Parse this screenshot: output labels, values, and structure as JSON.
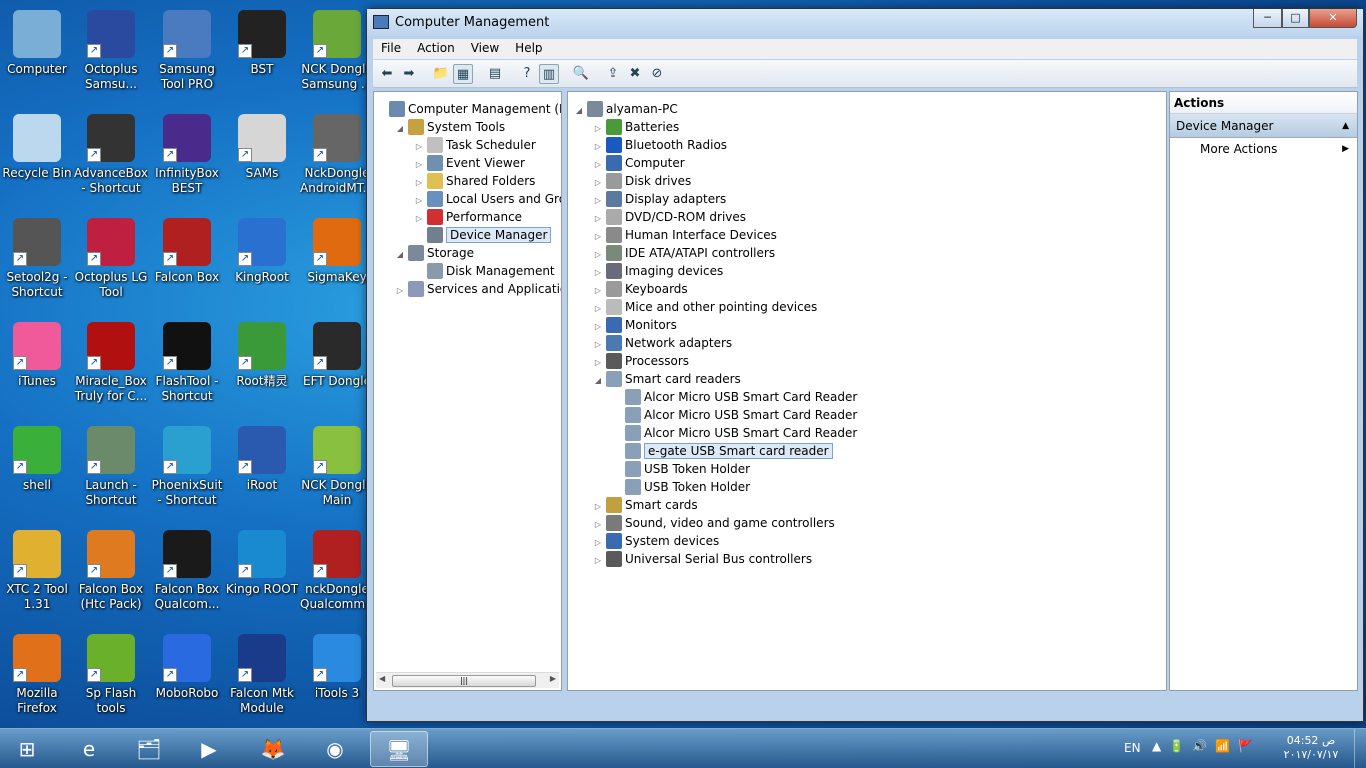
{
  "desktop": {
    "icons": [
      {
        "label": "Computer",
        "color": "#7aaed6"
      },
      {
        "label": "Octoplus Samsu...",
        "color": "#2a4aa0"
      },
      {
        "label": "Samsung Tool PRO",
        "color": "#4a7ac0"
      },
      {
        "label": "BST",
        "color": "#222222"
      },
      {
        "label": "NCK Dongle Samsung ...",
        "color": "#6aa83a"
      },
      {
        "label": "Recycle Bin",
        "color": "#bcd8ee"
      },
      {
        "label": "AdvanceBox - Shortcut",
        "color": "#333333"
      },
      {
        "label": "InfinityBox BEST",
        "color": "#4a2a8a"
      },
      {
        "label": "SAMs",
        "color": "#d6d6d6"
      },
      {
        "label": "NckDongle AndroidMT...",
        "color": "#666666"
      },
      {
        "label": "Setool2g - Shortcut",
        "color": "#555555"
      },
      {
        "label": "Octoplus LG Tool",
        "color": "#c02040"
      },
      {
        "label": "Falcon Box",
        "color": "#b02020"
      },
      {
        "label": "KingRoot",
        "color": "#2a70d0"
      },
      {
        "label": "SigmaKey",
        "color": "#e06a10"
      },
      {
        "label": "iTunes",
        "color": "#f05a9a"
      },
      {
        "label": "Miracle_Box Truly for C...",
        "color": "#b01010"
      },
      {
        "label": "FlashTool - Shortcut",
        "color": "#111111"
      },
      {
        "label": "Root精灵",
        "color": "#3a9a3a"
      },
      {
        "label": "EFT Dongle",
        "color": "#2a2a2a"
      },
      {
        "label": "shell",
        "color": "#3ab03a"
      },
      {
        "label": "Launch - Shortcut",
        "color": "#6a8a6a"
      },
      {
        "label": "PhoenixSuit - Shortcut",
        "color": "#2aa0d0"
      },
      {
        "label": "iRoot",
        "color": "#2a5ab0"
      },
      {
        "label": "NCK Dongle Main Modu...",
        "color": "#8ac040"
      },
      {
        "label": "XTC 2 Tool 1.31",
        "color": "#e0b030"
      },
      {
        "label": "Falcon Box (Htc Pack)",
        "color": "#e07a20"
      },
      {
        "label": "Falcon Box Qualcom...",
        "color": "#1a1a1a"
      },
      {
        "label": "Kingo ROOT",
        "color": "#1a8ad0"
      },
      {
        "label": "nckDongle Qualcomm...",
        "color": "#b02020"
      },
      {
        "label": "Mozilla Firefox",
        "color": "#e0701a"
      },
      {
        "label": "Sp Flash tools",
        "color": "#6ab02a"
      },
      {
        "label": "MoboRobo",
        "color": "#2a6ae0"
      },
      {
        "label": "Falcon Mtk Module",
        "color": "#1a3a8a"
      },
      {
        "label": "iTools 3",
        "color": "#2a8ae0"
      }
    ]
  },
  "window": {
    "title": "Computer Management",
    "minimize": "─",
    "maximize": "□",
    "close": "✕"
  },
  "menu": [
    "File",
    "Action",
    "View",
    "Help"
  ],
  "toolbar": [
    "back-icon",
    "forward-icon",
    "up-folder-icon",
    "show-hide-tree-icon",
    "properties-icon",
    "help-icon",
    "show-hide-action-pane-icon",
    "scan-hardware-icon",
    "update-driver-icon",
    "uninstall-icon",
    "disable-icon"
  ],
  "left_tree": [
    {
      "label": "Computer Management (Local",
      "exp": "",
      "color": "#6a8ab0",
      "indent": 0
    },
    {
      "label": "System Tools",
      "exp": "◢",
      "color": "#c8a040",
      "indent": 1
    },
    {
      "label": "Task Scheduler",
      "exp": "▷",
      "color": "#c0c0c0",
      "indent": 2
    },
    {
      "label": "Event Viewer",
      "exp": "▷",
      "color": "#7090b0",
      "indent": 2
    },
    {
      "label": "Shared Folders",
      "exp": "▷",
      "color": "#e0c050",
      "indent": 2
    },
    {
      "label": "Local Users and Groups",
      "exp": "▷",
      "color": "#6a90c0",
      "indent": 2
    },
    {
      "label": "Performance",
      "exp": "▷",
      "color": "#d03030",
      "indent": 2
    },
    {
      "label": "Device Manager",
      "exp": "",
      "color": "#708090",
      "indent": 2,
      "selected": true
    },
    {
      "label": "Storage",
      "exp": "◢",
      "color": "#7a8a9a",
      "indent": 1
    },
    {
      "label": "Disk Management",
      "exp": "",
      "color": "#8a9aaa",
      "indent": 2
    },
    {
      "label": "Services and Applications",
      "exp": "▷",
      "color": "#8a9ab8",
      "indent": 1
    }
  ],
  "device_tree": [
    {
      "label": "alyaman-PC",
      "exp": "◢",
      "color": "#7a8a9a",
      "indent": 0
    },
    {
      "label": "Batteries",
      "exp": "▷",
      "color": "#4a9a3a",
      "indent": 1
    },
    {
      "label": "Bluetooth Radios",
      "exp": "▷",
      "color": "#1a5ac0",
      "indent": 1
    },
    {
      "label": "Computer",
      "exp": "▷",
      "color": "#3a6ab0",
      "indent": 1
    },
    {
      "label": "Disk drives",
      "exp": "▷",
      "color": "#9a9a9a",
      "indent": 1
    },
    {
      "label": "Display adapters",
      "exp": "▷",
      "color": "#5a7aa0",
      "indent": 1
    },
    {
      "label": "DVD/CD-ROM drives",
      "exp": "▷",
      "color": "#aaaaaa",
      "indent": 1
    },
    {
      "label": "Human Interface Devices",
      "exp": "▷",
      "color": "#8a8a8a",
      "indent": 1
    },
    {
      "label": "IDE ATA/ATAPI controllers",
      "exp": "▷",
      "color": "#7a8a7a",
      "indent": 1
    },
    {
      "label": "Imaging devices",
      "exp": "▷",
      "color": "#6a6a7a",
      "indent": 1
    },
    {
      "label": "Keyboards",
      "exp": "▷",
      "color": "#9a9a9a",
      "indent": 1
    },
    {
      "label": "Mice and other pointing devices",
      "exp": "▷",
      "color": "#bbbbbb",
      "indent": 1
    },
    {
      "label": "Monitors",
      "exp": "▷",
      "color": "#3a6ab0",
      "indent": 1
    },
    {
      "label": "Network adapters",
      "exp": "▷",
      "color": "#4a7ab0",
      "indent": 1
    },
    {
      "label": "Processors",
      "exp": "▷",
      "color": "#5a5a5a",
      "indent": 1
    },
    {
      "label": "Smart card readers",
      "exp": "◢",
      "color": "#8aa0b8",
      "indent": 1
    },
    {
      "label": "Alcor Micro USB Smart Card Reader",
      "exp": "",
      "color": "#8aa0b8",
      "indent": 2
    },
    {
      "label": "Alcor Micro USB Smart Card Reader",
      "exp": "",
      "color": "#8aa0b8",
      "indent": 2
    },
    {
      "label": "Alcor Micro USB Smart Card Reader",
      "exp": "",
      "color": "#8aa0b8",
      "indent": 2
    },
    {
      "label": "e-gate USB Smart card reader",
      "exp": "",
      "color": "#8aa0b8",
      "indent": 2,
      "selected": true
    },
    {
      "label": "USB Token Holder",
      "exp": "",
      "color": "#8aa0b8",
      "indent": 2
    },
    {
      "label": "USB Token Holder",
      "exp": "",
      "color": "#8aa0b8",
      "indent": 2
    },
    {
      "label": "Smart cards",
      "exp": "▷",
      "color": "#c0a040",
      "indent": 1
    },
    {
      "label": "Sound, video and game controllers",
      "exp": "▷",
      "color": "#7a7a7a",
      "indent": 1
    },
    {
      "label": "System devices",
      "exp": "▷",
      "color": "#3a6ab0",
      "indent": 1
    },
    {
      "label": "Universal Serial Bus controllers",
      "exp": "▷",
      "color": "#5a5a5a",
      "indent": 1
    }
  ],
  "actions": {
    "header": "Actions",
    "section": "Device Manager",
    "section_arrow": "▲",
    "more": "More Actions",
    "more_arrow": "▶"
  },
  "taskbar": {
    "items": [
      "start-orb-icon",
      "internet-explorer-icon",
      "windows-explorer-icon",
      "media-player-icon",
      "firefox-icon",
      "chrome-icon",
      "computer-management-icon"
    ],
    "lang": "EN",
    "tray": [
      "▲",
      "🔋",
      "🔊",
      "📶",
      "🚩"
    ],
    "time": "04:52 ص",
    "date": "٢٠١٧/٠٧/١٧"
  }
}
